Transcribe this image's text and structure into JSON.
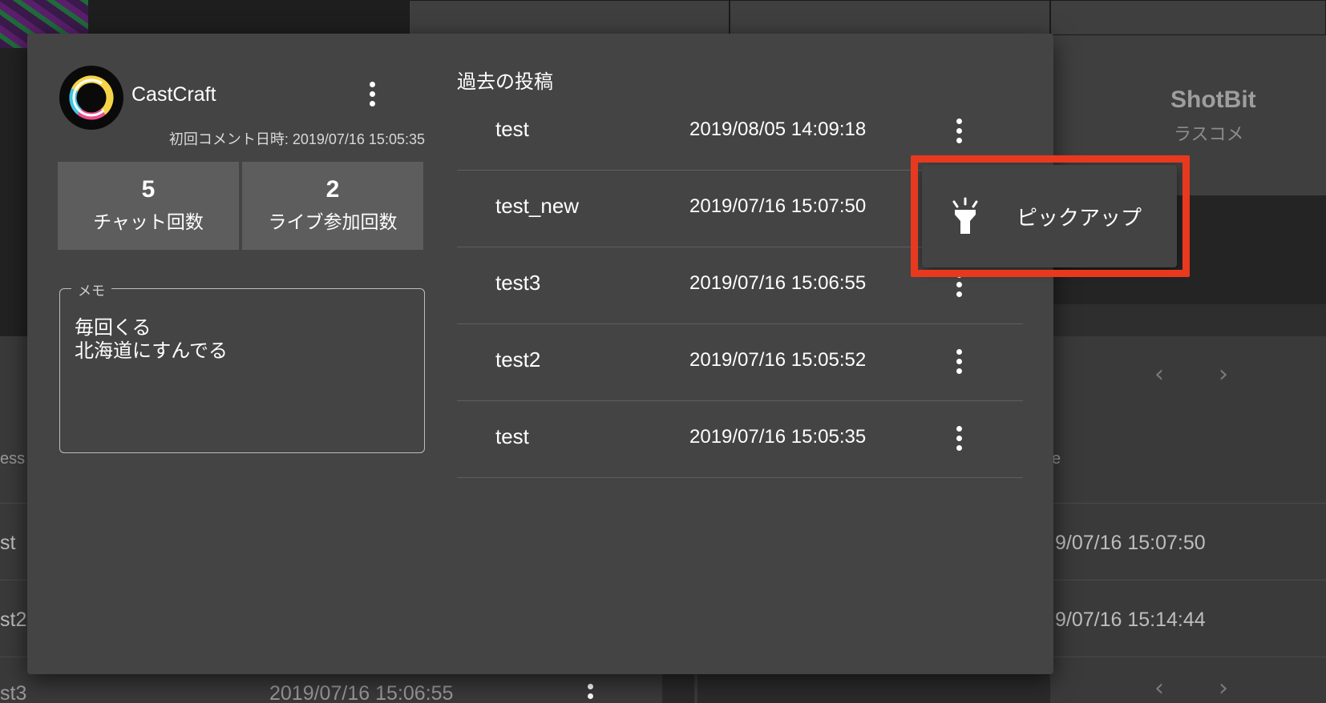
{
  "background": {
    "app_name": "ShotBit",
    "app_subtitle": "ラスコメ",
    "rows": [
      {
        "text_fragment": "st",
        "date_fragment": "9/07/16 15:07:50"
      },
      {
        "text_fragment": "st2",
        "date_fragment": "9/07/16 15:14:44"
      },
      {
        "text_fragment": "st3",
        "date": "2019/07/16 15:06:55"
      }
    ],
    "column_header_fragment_left": "ess",
    "column_header_fragment_right": "e"
  },
  "profile": {
    "avatar_icon": "castcraft-logo",
    "username": "CastCraft",
    "first_comment": "初回コメント日時: 2019/07/16 15:05:35",
    "stats": [
      {
        "value": "5",
        "label": "チャット回数"
      },
      {
        "value": "2",
        "label": "ライブ参加回数"
      }
    ],
    "memo": {
      "legend": "メモ",
      "lines": [
        "毎回くる",
        "北海道にすんでる"
      ]
    }
  },
  "posts": {
    "title": "過去の投稿",
    "items": [
      {
        "text": "test",
        "date": "2019/08/05 14:09:18"
      },
      {
        "text": "test_new",
        "date": "2019/07/16 15:07:50"
      },
      {
        "text": "test3",
        "date": "2019/07/16 15:06:55"
      },
      {
        "text": "test2",
        "date": "2019/07/16 15:05:52"
      },
      {
        "text": "test",
        "date": "2019/07/16 15:05:35"
      }
    ]
  },
  "menu": {
    "icon": "flashlight-icon",
    "label": "ピックアップ"
  },
  "colors": {
    "dialog_bg": "#444444",
    "highlight": "#e8391f",
    "stat_bg": "#5d5d5d"
  }
}
